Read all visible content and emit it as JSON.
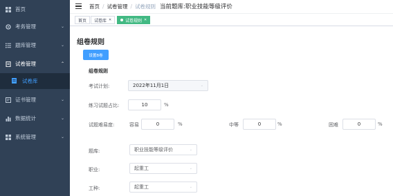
{
  "sidebar": {
    "items": [
      {
        "label": "首页",
        "icon": "dashboard-icon"
      },
      {
        "label": "考务管理",
        "icon": "gear-icon"
      },
      {
        "label": "题库管理",
        "icon": "list-icon"
      },
      {
        "label": "试卷管理",
        "icon": "document-icon"
      },
      {
        "label": "证书管理",
        "icon": "certificate-icon"
      },
      {
        "label": "数据统计",
        "icon": "bar-chart-icon"
      },
      {
        "label": "系统管理",
        "icon": "grid-icon"
      }
    ],
    "sub_item": {
      "label": "试卷库",
      "icon": "folder-icon"
    }
  },
  "header": {
    "breadcrumb": [
      "首页",
      "试卷管理",
      "试卷规则"
    ],
    "title": "当前题库:职业技能等级评价"
  },
  "tags": [
    {
      "label": "首页"
    },
    {
      "label": "试卷库"
    },
    {
      "label": "试卷规则"
    }
  ],
  "main": {
    "page_title": "组卷规则",
    "button_label": "设置B卷",
    "section_title": "组卷规则",
    "exam_plan": {
      "label": "考试计划:",
      "value": "2022年11月1日"
    },
    "practice_ratio": {
      "label": "练习试题占比:",
      "value": "10",
      "unit": "%"
    },
    "difficulty": {
      "label": "试题难易度:",
      "easy": {
        "label": "容易",
        "value": "0",
        "unit": "%"
      },
      "medium": {
        "label": "中等",
        "value": "0",
        "unit": "%"
      },
      "hard": {
        "label": "困难",
        "value": "0",
        "unit": "%"
      }
    },
    "question_bank": {
      "label": "题库:",
      "value": "职业技能等级评价"
    },
    "occupation": {
      "label": "职业:",
      "value": "起重工"
    },
    "job_type": {
      "label": "工种:",
      "value": "起重工"
    }
  },
  "colors": {
    "sidebar_bg": "#304156",
    "sidebar_active_bg": "#1f2d3d",
    "accent": "#409eff",
    "tag_active": "#42b983"
  }
}
